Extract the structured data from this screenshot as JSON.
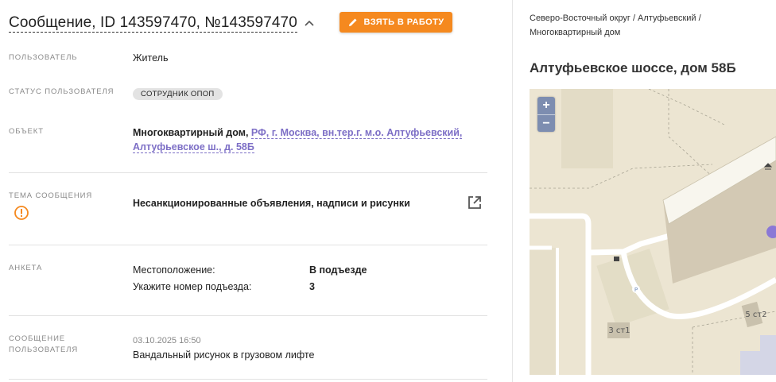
{
  "header": {
    "title": "Сообщение, ID 143597470, №143597470",
    "take_button": "ВЗЯТЬ В РАБОТУ"
  },
  "fields": {
    "user": {
      "label": "ПОЛЬЗОВАТЕЛЬ",
      "value": "Житель"
    },
    "user_status": {
      "label": "СТАТУС ПОЛЬЗОВАТЕЛЯ",
      "value": "СОТРУДНИК ОПОП"
    },
    "object": {
      "label": "ОБЪЕКТ",
      "prefix": "Многоквартирный дом, ",
      "link": "РФ, г. Москва, вн.тер.г. м.о. Алтуфьевский,",
      "link2": "Алтуфьевское ш., д. 58Б"
    },
    "topic": {
      "label": "ТЕМА СООБЩЕНИЯ",
      "value": "Несанкционированные объявления, надписи и рисунки"
    },
    "survey": {
      "label": "АНКЕТА",
      "rows": [
        {
          "q": "Местоположение:",
          "a": "В подъезде"
        },
        {
          "q": "Укажите номер подъезда:",
          "a": "3"
        }
      ]
    },
    "message": {
      "label1": "СООБЩЕНИЕ",
      "label2": "ПОЛЬЗОВАТЕЛЯ",
      "date": "03.10.2025 16:50",
      "text": "Вандальный рисунок в грузовом лифте"
    }
  },
  "right": {
    "breadcrumb_line1": "Северо-Восточный округ / Алтуфьевский /",
    "breadcrumb_line2": "Многоквартирный дом",
    "address": "Алтуфьевское шоссе, дом 58Б",
    "map": {
      "zoom_in": "+",
      "zoom_out": "−",
      "label_a": "3 ст1",
      "label_b": "5 ст2",
      "parking": "P"
    }
  },
  "colors": {
    "accent": "#f5891f",
    "link": "#7d6fc6",
    "warning": "#f5891f",
    "map_bg": "#ece4d0",
    "marker": "#8a78d6"
  }
}
